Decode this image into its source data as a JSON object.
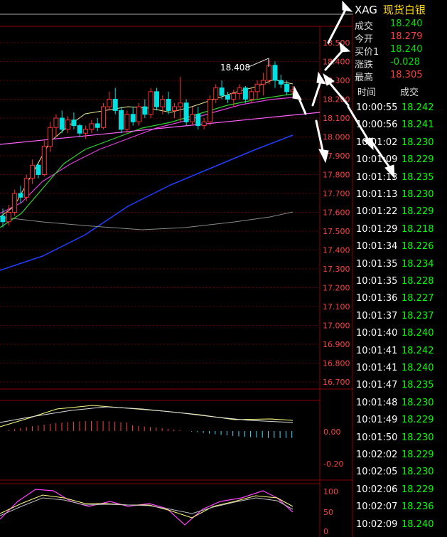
{
  "header": {
    "code": "XAG",
    "name": "现货白银"
  },
  "quote": [
    {
      "label": "成交",
      "value": "18.240",
      "color": "dn"
    },
    {
      "label": "今开",
      "value": "18.279",
      "color": "up"
    },
    {
      "label": "买价1",
      "value": "18.240",
      "color": "dn"
    },
    {
      "label": "涨跌",
      "value": "-0.028",
      "color": "dn"
    },
    {
      "label": "最高",
      "value": "18.305",
      "color": "up"
    }
  ],
  "trades_header": {
    "time": "时间",
    "price": "成交"
  },
  "trades": [
    {
      "time": "10:00:55",
      "price": "18.242"
    },
    {
      "time": "10:00:56",
      "price": "18.241"
    },
    {
      "time": "10:01:02",
      "price": "18.230"
    },
    {
      "time": "10:01:09",
      "price": "18.229"
    },
    {
      "time": "10:01:13",
      "price": "18.235"
    },
    {
      "time": "10:01:13",
      "price": "18.230"
    },
    {
      "time": "10:01:22",
      "price": "18.229"
    },
    {
      "time": "10:01:29",
      "price": "18.218"
    },
    {
      "time": "10:01:34",
      "price": "18.226"
    },
    {
      "time": "10:01:35",
      "price": "18.234"
    },
    {
      "time": "10:01:35",
      "price": "18.228"
    },
    {
      "time": "10:01:36",
      "price": "18.227"
    },
    {
      "time": "10:01:37",
      "price": "18.237"
    },
    {
      "time": "10:01:40",
      "price": "18.240"
    },
    {
      "time": "10:01:41",
      "price": "18.242"
    },
    {
      "time": "10:01:41",
      "price": "18.240"
    },
    {
      "time": "10:01:47",
      "price": "18.235"
    },
    {
      "time": "10:01:48",
      "price": "18.230"
    },
    {
      "time": "10:01:49",
      "price": "18.229"
    },
    {
      "time": "10:01:50",
      "price": "18.230"
    },
    {
      "time": "10:02:02",
      "price": "18.229"
    },
    {
      "time": "10:02:05",
      "price": "18.230"
    },
    {
      "time": "10:02:06",
      "price": "18.229"
    },
    {
      "time": "10:02:07",
      "price": "18.236"
    },
    {
      "time": "10:02:09",
      "price": "18.240"
    }
  ],
  "chart_data": {
    "type": "candlestick",
    "y_axis_ticks": [
      "18.500",
      "18.400",
      "18.300",
      "18.200",
      "18.100",
      "18.000",
      "17.900",
      "17.800",
      "17.700",
      "17.600",
      "17.500",
      "17.400",
      "17.300",
      "17.200",
      "17.100",
      "17.000",
      "16.900",
      "16.800",
      "16.700"
    ],
    "ylim": [
      16.65,
      18.58
    ],
    "annotation": "18.408",
    "candles": [
      [
        17.58,
        17.62,
        17.52,
        17.55
      ],
      [
        17.55,
        17.64,
        17.53,
        17.6
      ],
      [
        17.6,
        17.72,
        17.58,
        17.7
      ],
      [
        17.7,
        17.74,
        17.65,
        17.68
      ],
      [
        17.68,
        17.8,
        17.66,
        17.78
      ],
      [
        17.78,
        17.88,
        17.75,
        17.85
      ],
      [
        17.85,
        17.86,
        17.78,
        17.8
      ],
      [
        17.8,
        17.98,
        17.79,
        17.95
      ],
      [
        17.95,
        18.08,
        17.92,
        18.05
      ],
      [
        18.05,
        18.12,
        18.0,
        18.1
      ],
      [
        18.1,
        18.14,
        18.02,
        18.04
      ],
      [
        18.04,
        18.11,
        18.02,
        18.09
      ],
      [
        18.09,
        18.13,
        18.04,
        18.06
      ],
      [
        18.06,
        18.07,
        18.0,
        18.02
      ],
      [
        18.02,
        18.06,
        17.99,
        18.04
      ],
      [
        18.04,
        18.09,
        18.02,
        18.07
      ],
      [
        18.07,
        18.1,
        18.03,
        18.05
      ],
      [
        18.05,
        18.18,
        18.04,
        18.16
      ],
      [
        18.16,
        18.24,
        18.14,
        18.2
      ],
      [
        18.2,
        18.26,
        18.12,
        18.14
      ],
      [
        18.14,
        18.16,
        18.02,
        18.04
      ],
      [
        18.04,
        18.14,
        18.02,
        18.12
      ],
      [
        18.12,
        18.16,
        18.06,
        18.08
      ],
      [
        18.08,
        18.18,
        18.06,
        18.16
      ],
      [
        18.16,
        18.2,
        18.1,
        18.12
      ],
      [
        18.12,
        18.26,
        18.1,
        18.24
      ],
      [
        18.24,
        18.26,
        18.14,
        18.16
      ],
      [
        18.16,
        18.22,
        18.12,
        18.2
      ],
      [
        18.2,
        18.24,
        18.12,
        18.14
      ],
      [
        18.14,
        18.18,
        18.1,
        18.16
      ],
      [
        18.16,
        18.32,
        18.08,
        18.18
      ],
      [
        18.18,
        18.2,
        18.06,
        18.08
      ],
      [
        18.08,
        18.16,
        18.06,
        18.12
      ],
      [
        18.12,
        18.16,
        18.04,
        18.06
      ],
      [
        18.06,
        18.1,
        18.04,
        18.08
      ],
      [
        18.08,
        18.22,
        18.06,
        18.2
      ],
      [
        18.2,
        18.28,
        18.18,
        18.26
      ],
      [
        18.26,
        18.3,
        18.2,
        18.22
      ],
      [
        18.22,
        18.24,
        18.18,
        18.2
      ],
      [
        18.2,
        18.25,
        18.16,
        18.23
      ],
      [
        18.23,
        18.28,
        18.2,
        18.26
      ],
      [
        18.26,
        18.27,
        18.18,
        18.2
      ],
      [
        18.2,
        18.26,
        18.18,
        18.24
      ],
      [
        18.24,
        18.3,
        18.2,
        18.28
      ],
      [
        18.28,
        18.34,
        18.22,
        18.3
      ],
      [
        18.3,
        18.41,
        18.28,
        18.38
      ],
      [
        18.38,
        18.4,
        18.26,
        18.3
      ],
      [
        18.3,
        18.33,
        18.26,
        18.28
      ],
      [
        18.28,
        18.3,
        18.22,
        18.24
      ],
      [
        18.24,
        18.27,
        18.22,
        18.25
      ]
    ],
    "macd_ticks": [
      "0.00",
      "-0.20"
    ],
    "kdj_ticks": [
      "100",
      "50",
      "0"
    ]
  }
}
